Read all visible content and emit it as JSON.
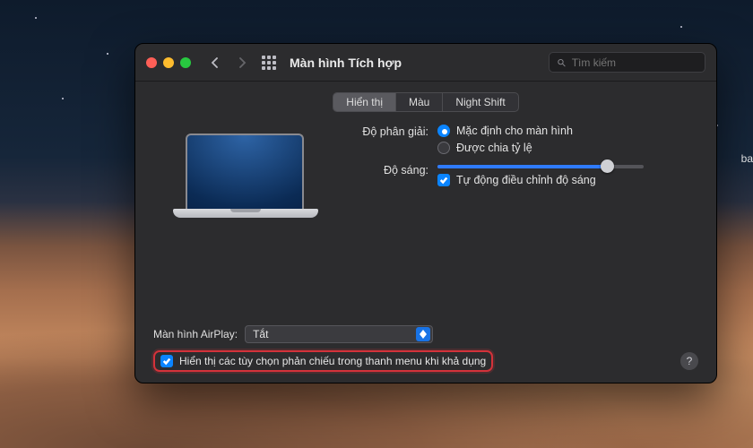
{
  "edge_badge": "ba",
  "window": {
    "title": "Màn hình Tích hợp",
    "search_placeholder": "Tìm kiếm",
    "tabs": [
      {
        "label": "Hiển thị",
        "active": true
      },
      {
        "label": "Màu",
        "active": false
      },
      {
        "label": "Night Shift",
        "active": false
      }
    ],
    "resolution": {
      "label": "Độ phân giải:",
      "options": [
        {
          "label": "Mặc định cho màn hình",
          "checked": true
        },
        {
          "label": "Được chia tỷ lệ",
          "checked": false
        }
      ]
    },
    "brightness": {
      "label": "Độ sáng:",
      "value_percent": 82,
      "auto_label": "Tự động điều chỉnh độ sáng",
      "auto_checked": true
    },
    "airplay": {
      "label": "Màn hình AirPlay:",
      "value": "Tắt"
    },
    "menu_bar_option": {
      "label": "Hiển thị các tùy chọn phản chiếu trong thanh menu khi khả dụng",
      "checked": true
    },
    "help_glyph": "?"
  }
}
